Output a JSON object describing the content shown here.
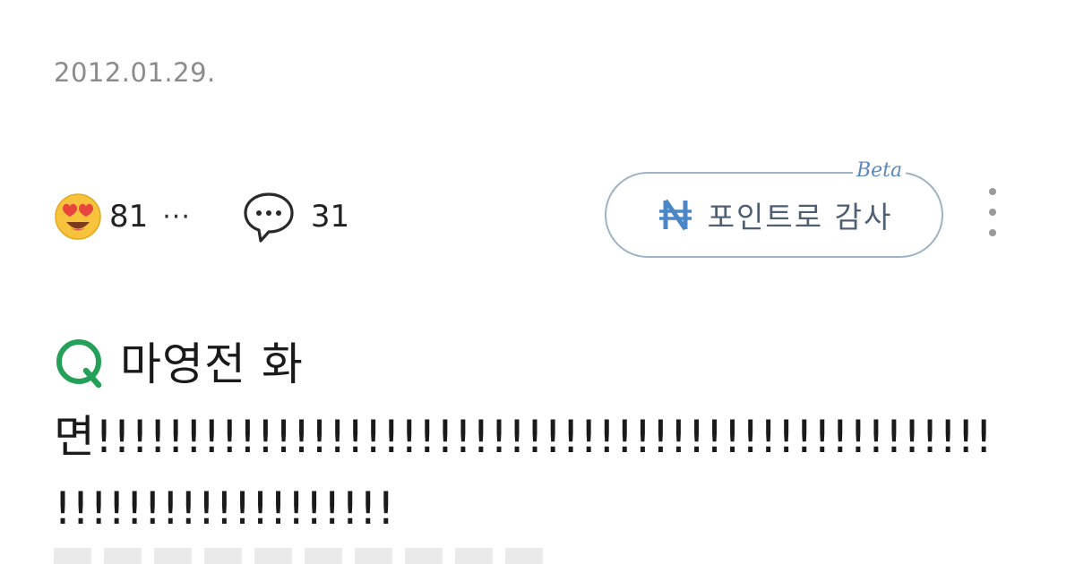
{
  "post": {
    "date": "2012.01.29.",
    "reactions": {
      "icon": "heart-eyes-emoji-icon",
      "count": "81",
      "more": "···"
    },
    "comments": {
      "icon": "speech-bubble-icon",
      "count": "31"
    },
    "point_button": {
      "icon": "naver-point-icon",
      "label": "포인트로 감사",
      "badge": "Beta",
      "accent": "#5c88bd",
      "border": "#9fb3c8"
    },
    "more_menu_icon": "kebab-menu-icon"
  },
  "qa": {
    "icon": "question-q-icon",
    "icon_color": "#25a058",
    "title": "마영전 화",
    "body": "면!!!!!!!!!!!!!!!!!!!!!!!!!!!!!!!!!!!!!!!!!!!!!!!!!!!!!!!!!!!!!!!!!!!!!"
  }
}
